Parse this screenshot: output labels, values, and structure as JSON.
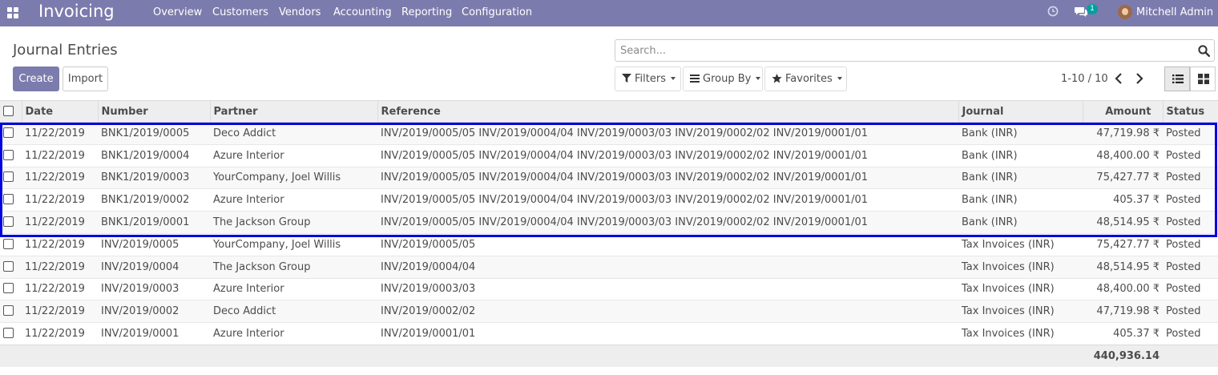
{
  "navbar": {
    "app_title": "Invoicing",
    "menu": [
      "Overview",
      "Customers",
      "Vendors",
      "Accounting",
      "Reporting",
      "Configuration"
    ],
    "chat_badge": "1",
    "user_name": "Mitchell Admin",
    "bg_color": "#7c7bad"
  },
  "control_panel": {
    "title": "Journal Entries",
    "create_label": "Create",
    "import_label": "Import",
    "search_placeholder": "Search...",
    "filters_label": "Filters",
    "group_by_label": "Group By",
    "favorites_label": "Favorites",
    "pager": "1-10 / 10"
  },
  "table": {
    "columns": [
      "Date",
      "Number",
      "Partner",
      "Reference",
      "Journal",
      "Amount",
      "Status"
    ],
    "rows": [
      [
        "11/22/2019",
        "BNK1/2019/0005",
        "Deco Addict",
        "INV/2019/0005/05 INV/2019/0004/04 INV/2019/0003/03 INV/2019/0002/02 INV/2019/0001/01",
        "Bank (INR)",
        "47,719.98 ₹",
        "Posted"
      ],
      [
        "11/22/2019",
        "BNK1/2019/0004",
        "Azure Interior",
        "INV/2019/0005/05 INV/2019/0004/04 INV/2019/0003/03 INV/2019/0002/02 INV/2019/0001/01",
        "Bank (INR)",
        "48,400.00 ₹",
        "Posted"
      ],
      [
        "11/22/2019",
        "BNK1/2019/0003",
        "YourCompany, Joel Willis",
        "INV/2019/0005/05 INV/2019/0004/04 INV/2019/0003/03 INV/2019/0002/02 INV/2019/0001/01",
        "Bank (INR)",
        "75,427.77 ₹",
        "Posted"
      ],
      [
        "11/22/2019",
        "BNK1/2019/0002",
        "Azure Interior",
        "INV/2019/0005/05 INV/2019/0004/04 INV/2019/0003/03 INV/2019/0002/02 INV/2019/0001/01",
        "Bank (INR)",
        "405.37 ₹",
        "Posted"
      ],
      [
        "11/22/2019",
        "BNK1/2019/0001",
        "The Jackson Group",
        "INV/2019/0005/05 INV/2019/0004/04 INV/2019/0003/03 INV/2019/0002/02 INV/2019/0001/01",
        "Bank (INR)",
        "48,514.95 ₹",
        "Posted"
      ],
      [
        "11/22/2019",
        "INV/2019/0005",
        "YourCompany, Joel Willis",
        "INV/2019/0005/05",
        "Tax Invoices (INR)",
        "75,427.77 ₹",
        "Posted"
      ],
      [
        "11/22/2019",
        "INV/2019/0004",
        "The Jackson Group",
        "INV/2019/0004/04",
        "Tax Invoices (INR)",
        "48,514.95 ₹",
        "Posted"
      ],
      [
        "11/22/2019",
        "INV/2019/0003",
        "Azure Interior",
        "INV/2019/0003/03",
        "Tax Invoices (INR)",
        "48,400.00 ₹",
        "Posted"
      ],
      [
        "11/22/2019",
        "INV/2019/0002",
        "Deco Addict",
        "INV/2019/0002/02",
        "Tax Invoices (INR)",
        "47,719.98 ₹",
        "Posted"
      ],
      [
        "11/22/2019",
        "INV/2019/0001",
        "Azure Interior",
        "INV/2019/0001/01",
        "Tax Invoices (INR)",
        "405.37 ₹",
        "Posted"
      ]
    ],
    "total": "440,936.14",
    "highlight_color": "#0000dd"
  }
}
